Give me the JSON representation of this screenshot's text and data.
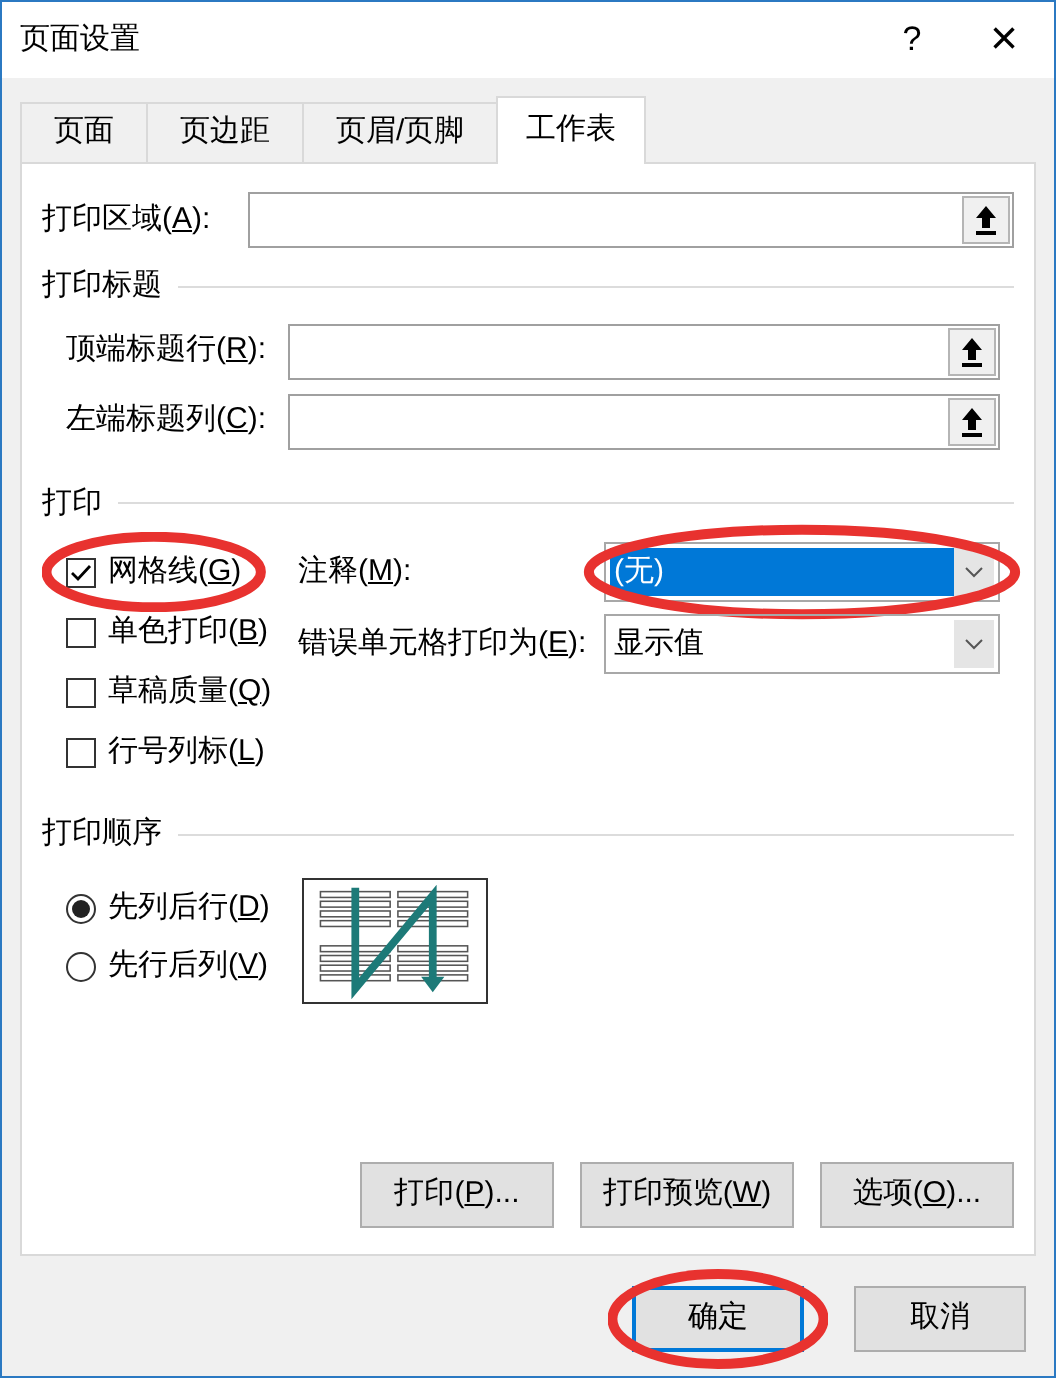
{
  "window": {
    "title": "页面设置",
    "help": "?",
    "close": "×"
  },
  "tabs": [
    {
      "label": "页面",
      "selected": false
    },
    {
      "label": "页边距",
      "selected": false
    },
    {
      "label": "页眉/页脚",
      "selected": false
    },
    {
      "label": "工作表",
      "selected": true
    }
  ],
  "print_area": {
    "label": [
      "打印区域(",
      "A",
      "):"
    ]
  },
  "print_titles": {
    "heading": "打印标题",
    "fields": [
      {
        "label": [
          "顶端标题行(",
          "R",
          "):"
        ]
      },
      {
        "label": [
          "左端标题列(",
          "C",
          "):"
        ]
      }
    ]
  },
  "print": {
    "heading": "打印",
    "checkboxes": [
      {
        "label": [
          "网格线(",
          "G",
          ")"
        ],
        "checked": true,
        "circled": true
      },
      {
        "label": [
          "单色打印(",
          "B",
          ")"
        ],
        "checked": false,
        "circled": false
      },
      {
        "label": [
          "草稿质量(",
          "Q",
          ")"
        ],
        "checked": false,
        "circled": false
      },
      {
        "label": [
          "行号列标(",
          "L",
          ")"
        ],
        "checked": false,
        "circled": false
      }
    ],
    "dropdowns": [
      {
        "label": [
          "注释(",
          "M",
          "):"
        ],
        "value": "(无)",
        "focused": true,
        "circled": true
      },
      {
        "label": [
          "错误单元格打印为(",
          "E",
          "):"
        ],
        "value": "显示值",
        "focused": false,
        "circled": false
      }
    ]
  },
  "print_order": {
    "heading": "打印顺序",
    "options": [
      {
        "label": [
          "先列后行(",
          "D",
          ")"
        ],
        "selected": true
      },
      {
        "label": [
          "先行后列(",
          "V",
          ")"
        ],
        "selected": false
      }
    ]
  },
  "panel_buttons": [
    {
      "label": [
        "打印(",
        "P",
        ")..."
      ]
    },
    {
      "label": [
        "打印预览(",
        "W",
        ")"
      ]
    },
    {
      "label": [
        "选项(",
        "O",
        ")..."
      ]
    }
  ],
  "dialog_buttons": [
    {
      "label": "确定",
      "default": true,
      "circled": true
    },
    {
      "label": "取消",
      "default": false,
      "circled": false
    }
  ]
}
